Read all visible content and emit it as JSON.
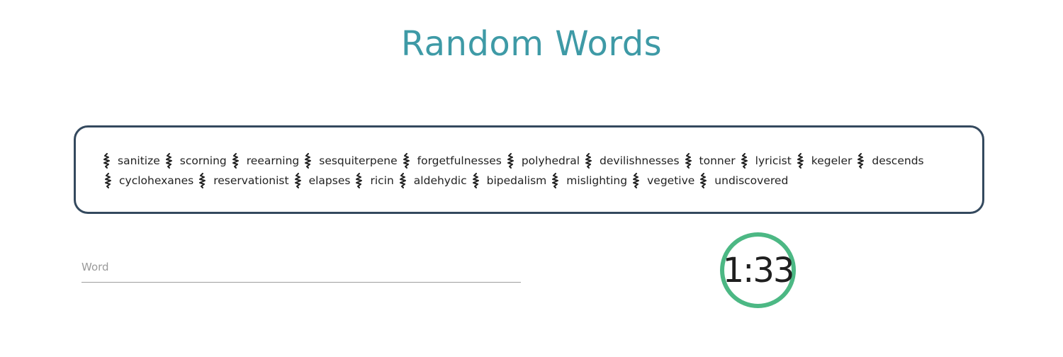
{
  "header": {
    "title": "Random Words"
  },
  "words": {
    "separator_icon": "squiggle-icon",
    "items": [
      "sanitize",
      "scorning",
      "reearning",
      "sesquiterpene",
      "forgetfulnesses",
      "polyhedral",
      "devilishnesses",
      "tonner",
      "lyricist",
      "kegeler",
      "descends",
      "cyclohexanes",
      "reservationist",
      "elapses",
      "ricin",
      "aldehydic",
      "bipedalism",
      "mislighting",
      "vegetive",
      "undiscovered"
    ]
  },
  "input": {
    "placeholder": "Word",
    "value": ""
  },
  "timer": {
    "display": "1:33"
  },
  "colors": {
    "title": "#3e9aa6",
    "box_border": "#34495e",
    "timer_ring": "#4cb884"
  }
}
